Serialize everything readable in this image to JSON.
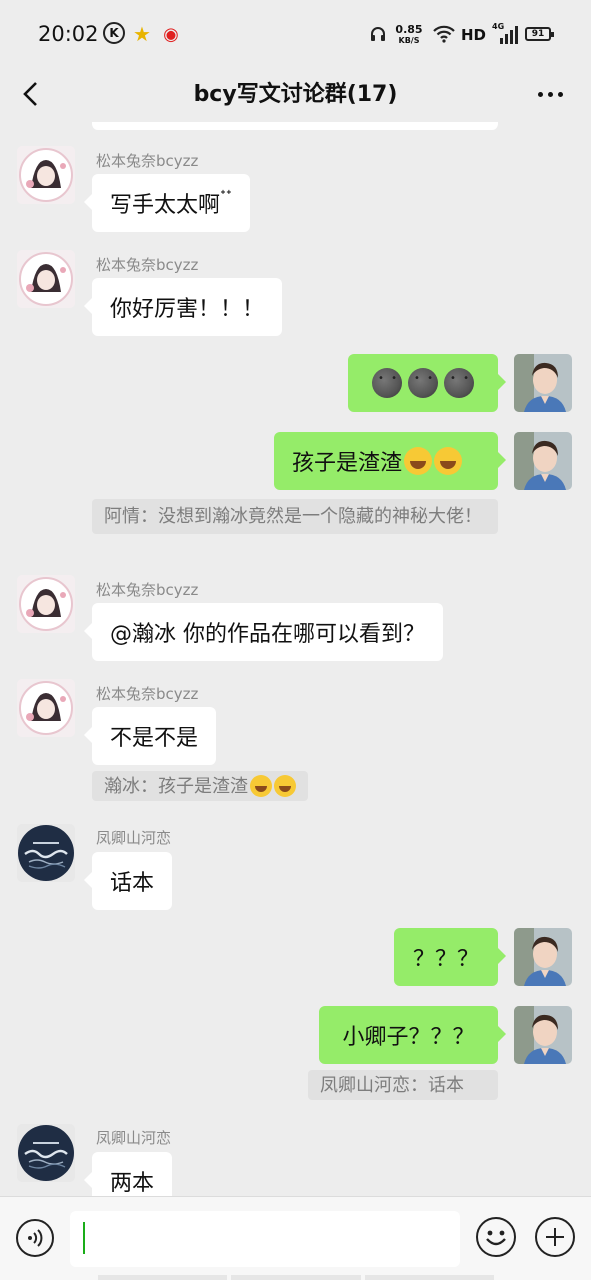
{
  "status_bar": {
    "time": "20:02",
    "k_badge": "K",
    "speed_value": "0.85",
    "speed_unit": "KB/S",
    "network": "HD",
    "signal": "4G",
    "battery": "91",
    "icons": [
      "k-icon",
      "star-icon",
      "weibo-icon",
      "headset-icon",
      "wifi-icon",
      "signal-icon",
      "battery-icon"
    ]
  },
  "header": {
    "title": "bcy写文讨论群(17)",
    "back_icon": "chevron-left-icon",
    "more_icon": "more-icon"
  },
  "messages": [
    {
      "side": "left",
      "sender": "松本兔奈bcyzz",
      "text": "写手太太啊",
      "suffix": "ᐩᐩ"
    },
    {
      "side": "left",
      "sender": "松本兔奈bcyzz",
      "text": "你好厉害！！！"
    },
    {
      "side": "right",
      "emoji": [
        "new-moon-face-emoji",
        "new-moon-face-emoji",
        "new-moon-face-emoji"
      ]
    },
    {
      "side": "right",
      "text": "孩子是渣渣",
      "emoji": [
        "rolling-laughing-emoji",
        "rolling-laughing-emoji"
      ],
      "quote": "阿情：没想到瀚冰竟然是一个隐藏的神秘大佬！"
    },
    {
      "side": "left",
      "sender": "松本兔奈bcyzz",
      "text": "@瀚冰  你的作品在哪可以看到？"
    },
    {
      "side": "left",
      "sender": "松本兔奈bcyzz",
      "text": "不是不是",
      "quote": "瀚冰：孩子是渣渣"
    },
    {
      "side": "left",
      "sender": "凤卿山河恋",
      "text": "话本"
    },
    {
      "side": "right",
      "text": "？？？"
    },
    {
      "side": "right",
      "text": "小卿子？？？",
      "quote": "凤卿山河恋：话本"
    },
    {
      "side": "left",
      "sender": "凤卿山河恋",
      "text": "两本"
    }
  ],
  "input": {
    "value": "",
    "voice_icon": "voice-icon",
    "emoji_icon": "smile-icon",
    "plus_icon": "plus-icon"
  },
  "colors": {
    "background": "#ededed",
    "bubble_out": "#95ec69",
    "bubble_in": "#ffffff",
    "quote_bg": "#e1e1e1",
    "caret": "#1aad19"
  }
}
